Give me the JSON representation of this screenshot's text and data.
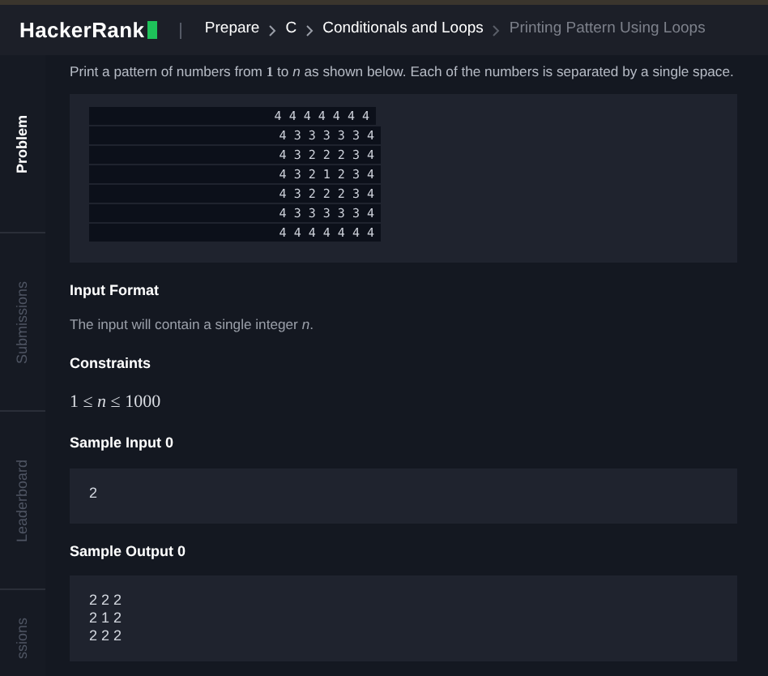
{
  "header": {
    "logo": "HackerRank",
    "breadcrumb": [
      {
        "label": "Prepare",
        "current": false
      },
      {
        "label": "C",
        "current": false
      },
      {
        "label": "Conditionals and Loops",
        "current": false
      },
      {
        "label": "Printing Pattern Using Loops",
        "current": true
      }
    ]
  },
  "sidebar": {
    "tabs": [
      {
        "label": "Problem",
        "selected": true
      },
      {
        "label": "Submissions",
        "selected": false
      },
      {
        "label": "Leaderboard",
        "selected": false
      },
      {
        "label": "ssions",
        "selected": false
      }
    ]
  },
  "problem": {
    "intro": "Print a pattern of numbers from **1** to *n* as shown below. Each of the numbers is separated by a single space.",
    "pattern": [
      "4 4 4 4 4 4 4",
      "4 3 3 3 3 3 4",
      "4 3 2 2 2 3 4",
      "4 3 2 1 2 3 4",
      "4 3 2 2 2 3 4",
      "4 3 3 3 3 3 4",
      "4 4 4 4 4 4 4"
    ],
    "sections": [
      {
        "kind": "text",
        "heading": "Input Format",
        "body": "The input will contain a single integer *n*."
      },
      {
        "kind": "math",
        "heading": "Constraints",
        "body": "1 ≤ *n* ≤ 1000"
      },
      {
        "kind": "code",
        "heading": "Sample Input 0",
        "lines": [
          "2"
        ]
      },
      {
        "kind": "code",
        "heading": "Sample Output 0",
        "lines": [
          "2 2 2",
          "2 1 2",
          "2 2 2"
        ]
      }
    ]
  }
}
